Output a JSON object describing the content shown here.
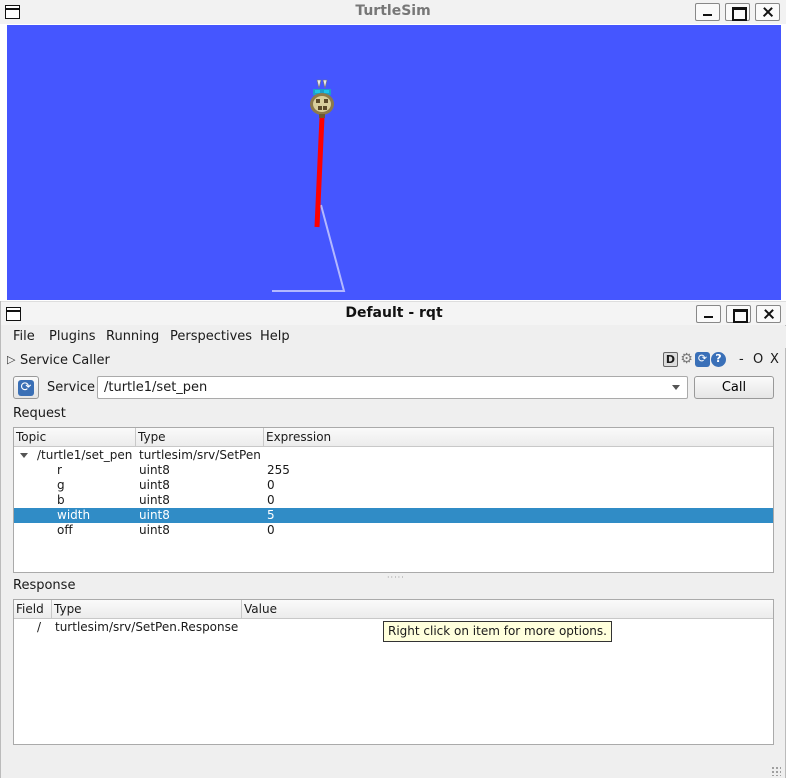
{
  "turtlesim": {
    "window_title": "TurtleSim",
    "background_color": "#4556ff",
    "pen_colors": {
      "current": "#ff0000",
      "previous": "#b3b8ff"
    }
  },
  "rqt": {
    "window_title": "Default - rqt",
    "menu": [
      "File",
      "Plugins",
      "Running",
      "Perspectives",
      "Help"
    ],
    "plugin": {
      "title": "Service Caller",
      "toolbar_buttons": {
        "d": "D",
        "gear": "⚙",
        "reload": "⟳",
        "help": "?",
        "minimize": "-",
        "float": "O",
        "close": "X"
      }
    },
    "service": {
      "label": "Service",
      "value": "/turtle1/set_pen",
      "call_label": "Call",
      "refresh_icon": "⟳"
    },
    "request": {
      "label": "Request",
      "columns": [
        "Topic",
        "Type",
        "Expression"
      ],
      "root": {
        "topic": "/turtle1/set_pen",
        "type": "turtlesim/srv/SetPen",
        "expression": ""
      },
      "rows": [
        {
          "topic": "r",
          "type": "uint8",
          "expression": "255"
        },
        {
          "topic": "g",
          "type": "uint8",
          "expression": "0"
        },
        {
          "topic": "b",
          "type": "uint8",
          "expression": "0"
        },
        {
          "topic": "width",
          "type": "uint8",
          "expression": "5"
        },
        {
          "topic": "off",
          "type": "uint8",
          "expression": "0"
        }
      ],
      "selected_row": "width"
    },
    "response": {
      "label": "Response",
      "columns": [
        "Field",
        "Type",
        "Value"
      ],
      "rows": [
        {
          "field": "/",
          "type": "turtlesim/srv/SetPen.Response",
          "value": ""
        }
      ]
    },
    "tooltip": "Right click on item for more options.",
    "selection_color": "#308cc6"
  }
}
